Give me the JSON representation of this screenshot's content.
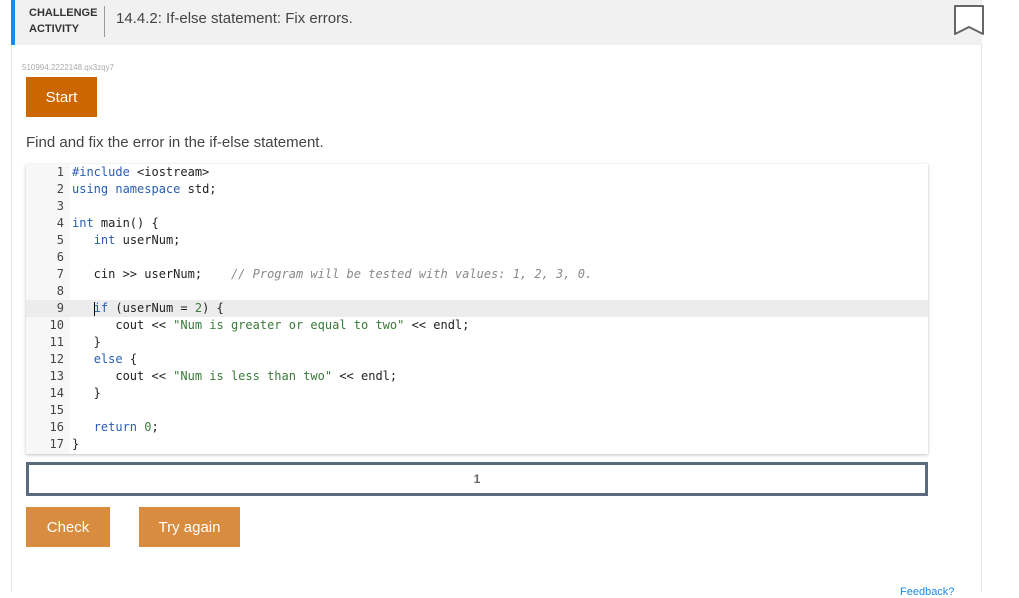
{
  "header": {
    "label_line1": "CHALLENGE",
    "label_line2": "ACTIVITY",
    "title": "14.4.2: If-else statement: Fix errors."
  },
  "activity_id": "510994.2222148.qx3zqy7",
  "buttons": {
    "start": "Start",
    "check": "Check",
    "try_again": "Try again"
  },
  "instructions": "Find and fix the error in the if-else statement.",
  "code_lines": [
    {
      "n": "1",
      "text": "#include <iostream>"
    },
    {
      "n": "2",
      "text": "using namespace std;"
    },
    {
      "n": "3",
      "text": ""
    },
    {
      "n": "4",
      "text": "int main() {"
    },
    {
      "n": "5",
      "text": "   int userNum;"
    },
    {
      "n": "6",
      "text": ""
    },
    {
      "n": "7",
      "text": "   cin >> userNum;    // Program will be tested with values: 1, 2, 3, 0."
    },
    {
      "n": "8",
      "text": ""
    },
    {
      "n": "9",
      "text": "   if (userNum = 2) {"
    },
    {
      "n": "10",
      "text": "      cout << \"Num is greater or equal to two\" << endl;"
    },
    {
      "n": "11",
      "text": "   }"
    },
    {
      "n": "12",
      "text": "   else {"
    },
    {
      "n": "13",
      "text": "      cout << \"Num is less than two\" << endl;"
    },
    {
      "n": "14",
      "text": "   }"
    },
    {
      "n": "15",
      "text": ""
    },
    {
      "n": "16",
      "text": "   return 0;"
    },
    {
      "n": "17",
      "text": "}"
    }
  ],
  "progress": {
    "current_step": "1"
  },
  "feedback_link": "Feedback?"
}
